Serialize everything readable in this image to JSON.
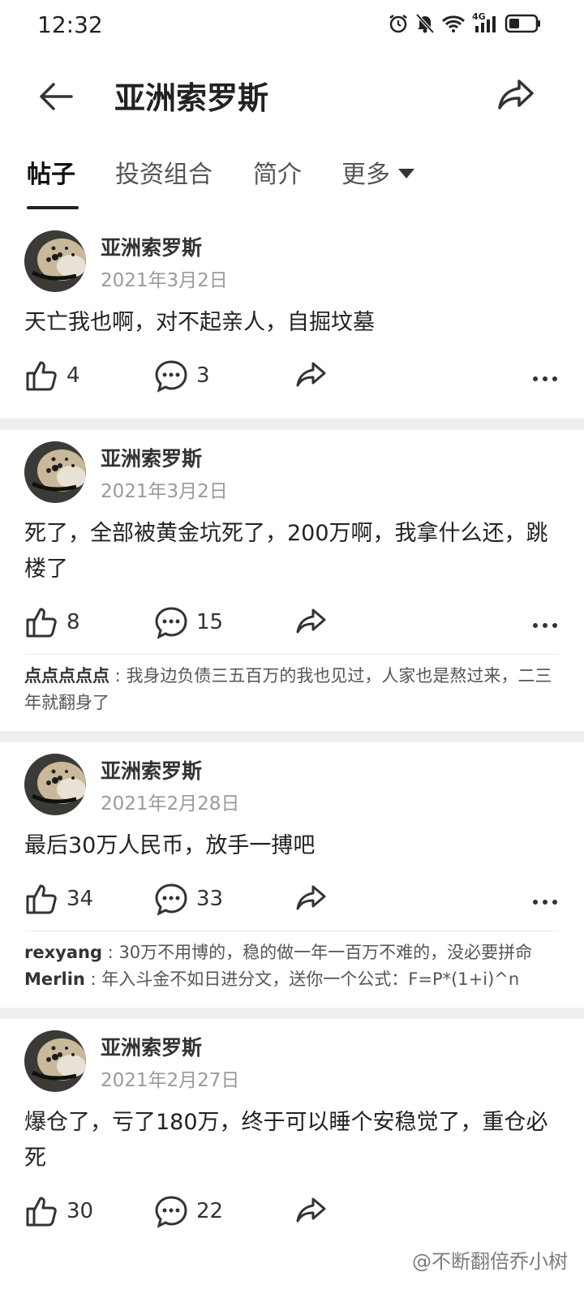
{
  "status": {
    "time": "12:32",
    "network": "4G"
  },
  "appbar": {
    "title": "亚洲索罗斯"
  },
  "tabs": [
    {
      "label": "帖子"
    },
    {
      "label": "投资组合"
    },
    {
      "label": "简介"
    },
    {
      "label": "更多"
    }
  ],
  "posts": [
    {
      "author": "亚洲索罗斯",
      "date": "2021年3月2日",
      "text": "天亡我也啊，对不起亲人，自掘坟墓",
      "likes": "4",
      "comments_count": "3",
      "comments": []
    },
    {
      "author": "亚洲索罗斯",
      "date": "2021年3月2日",
      "text": "死了，全部被黄金坑死了，200万啊，我拿什么还，跳楼了",
      "likes": "8",
      "comments_count": "15",
      "comments": [
        {
          "user": "点点点点点",
          "text": "我身边负债三五百万的我也见过，人家也是熬过来，二三年就翻身了"
        }
      ]
    },
    {
      "author": "亚洲索罗斯",
      "date": "2021年2月28日",
      "text": "最后30万人民币，放手一搏吧",
      "likes": "34",
      "comments_count": "33",
      "comments": [
        {
          "user": "rexyang",
          "text": "30万不用博的，稳的做一年一百万不难的，没必要拼命"
        },
        {
          "user": "Merlin",
          "text": "年入斗金不如日进分文，送你一个公式：F=P*(1+i)^n"
        }
      ]
    },
    {
      "author": "亚洲索罗斯",
      "date": "2021年2月27日",
      "text": "爆仓了，亏了180万，终于可以睡个安稳觉了，重仓必死",
      "likes": "30",
      "comments_count": "22",
      "comments": []
    }
  ],
  "watermark": "@不断翻倍乔小树"
}
